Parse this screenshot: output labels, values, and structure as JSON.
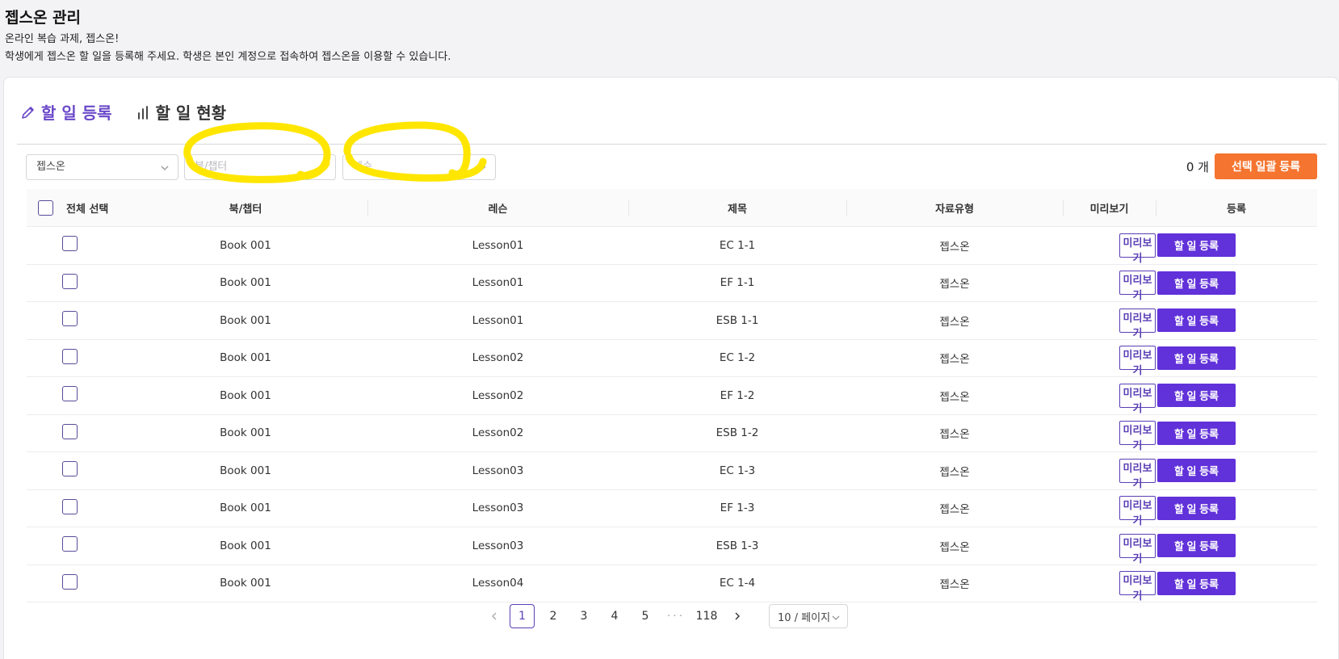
{
  "page": {
    "title": "젭스온 관리",
    "desc1": "온라인 복습 과제, 젭스온!",
    "desc2": "학생에게 젭스온 할 일을 등록해 주세요. 학생은 본인 계정으로 접속하여 젭스온을 이용할 수 있습니다."
  },
  "tabs": {
    "register": "할 일 등록",
    "status": "할 일 현황"
  },
  "filters": {
    "type_value": "젭스온",
    "book_placeholder": "북/챕터",
    "lesson_placeholder": "레슨"
  },
  "count_label": "0 개",
  "bulk_button": "선택 일괄 등록",
  "headers": {
    "select_all": "전체 선택",
    "book": "북/챕터",
    "lesson": "레슨",
    "title": "제목",
    "type": "자료유형",
    "preview": "미리보기",
    "register": "등록"
  },
  "row_buttons": {
    "preview": "미리보기",
    "register": "할 일 등록"
  },
  "rows": [
    {
      "book": "Book 001",
      "lesson": "Lesson01",
      "title": "EC 1-1",
      "type": "젭스온"
    },
    {
      "book": "Book 001",
      "lesson": "Lesson01",
      "title": "EF 1-1",
      "type": "젭스온"
    },
    {
      "book": "Book 001",
      "lesson": "Lesson01",
      "title": "ESB 1-1",
      "type": "젭스온"
    },
    {
      "book": "Book 001",
      "lesson": "Lesson02",
      "title": "EC 1-2",
      "type": "젭스온"
    },
    {
      "book": "Book 001",
      "lesson": "Lesson02",
      "title": "EF 1-2",
      "type": "젭스온"
    },
    {
      "book": "Book 001",
      "lesson": "Lesson02",
      "title": "ESB 1-2",
      "type": "젭스온"
    },
    {
      "book": "Book 001",
      "lesson": "Lesson03",
      "title": "EC 1-3",
      "type": "젭스온"
    },
    {
      "book": "Book 001",
      "lesson": "Lesson03",
      "title": "EF 1-3",
      "type": "젭스온"
    },
    {
      "book": "Book 001",
      "lesson": "Lesson03",
      "title": "ESB 1-3",
      "type": "젭스온"
    },
    {
      "book": "Book 001",
      "lesson": "Lesson04",
      "title": "EC 1-4",
      "type": "젭스온"
    }
  ],
  "pagination": {
    "pages": [
      "1",
      "2",
      "3",
      "4",
      "5"
    ],
    "dots": "···",
    "last": "118",
    "current": "1",
    "page_size": "10 / 페이지"
  },
  "colors": {
    "accent": "#6131d9",
    "tab_active": "#6a48c9",
    "bulk": "#f5742f",
    "highlight": "#ffe600"
  }
}
